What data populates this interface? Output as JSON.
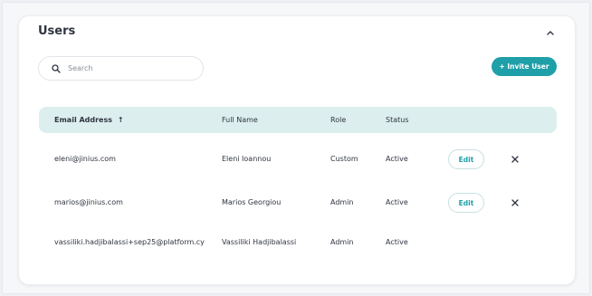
{
  "card": {
    "title": "Users"
  },
  "search": {
    "placeholder": "Search",
    "value": ""
  },
  "invite_button": {
    "label": "+ Invite User"
  },
  "table": {
    "columns": [
      {
        "label": "Email Address",
        "sorted": "ascending"
      },
      {
        "label": "Full Name"
      },
      {
        "label": "Role"
      },
      {
        "label": "Status"
      }
    ],
    "sort_indicator": "↑",
    "rows": [
      {
        "email": "eleni@jinius.com",
        "full_name": "Eleni Ioannou",
        "role": "Custom",
        "status": "Active",
        "edit_label": "Edit",
        "deletable": true
      },
      {
        "email": "marios@jinius.com",
        "full_name": "Marios Georgiou",
        "role": "Admin",
        "status": "Active",
        "edit_label": "Edit",
        "deletable": true
      },
      {
        "email": "vassiliki.hadjibalassi+sep25@platform.cy",
        "full_name": "Vassiliki Hadjibalassi",
        "role": "Admin",
        "status": "Active",
        "edit_label": "",
        "deletable": false
      }
    ]
  },
  "icons": {
    "search": "search-icon",
    "collapse": "chevron-up-icon",
    "delete": "close-icon"
  },
  "colors": {
    "accent": "#1f9fa8",
    "header_bg": "#dcefee"
  }
}
